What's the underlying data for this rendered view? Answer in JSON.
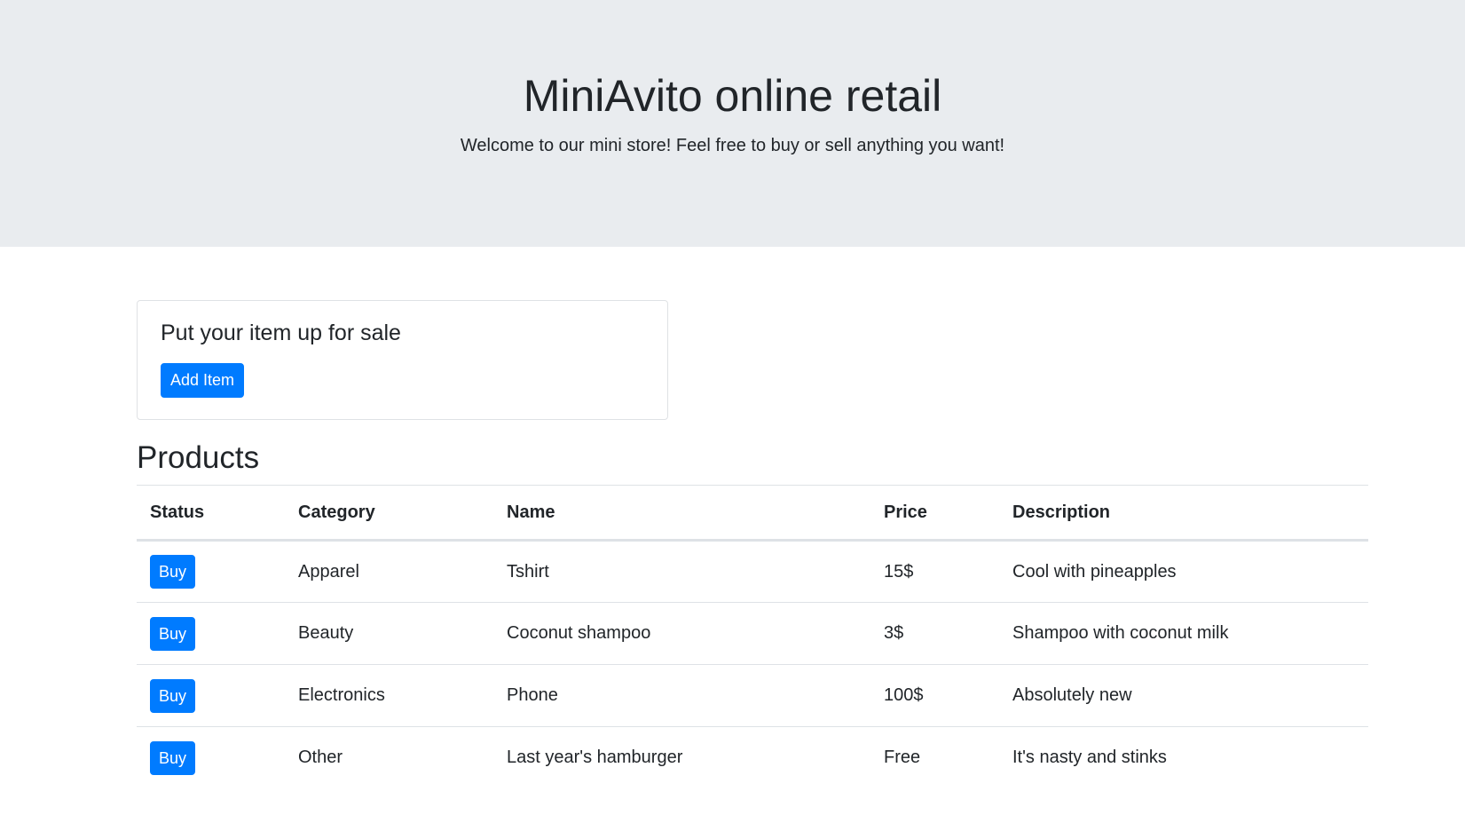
{
  "header": {
    "title": "MiniAvito online retail",
    "subtitle": "Welcome to our mini store! Feel free to buy or sell anything you want!"
  },
  "sell_card": {
    "heading": "Put your item up for sale",
    "add_button": "Add Item"
  },
  "products": {
    "title": "Products",
    "columns": {
      "status": "Status",
      "category": "Category",
      "name": "Name",
      "price": "Price",
      "description": "Description"
    },
    "rows": [
      {
        "button": "Buy",
        "category": "Apparel",
        "name": "Tshirt",
        "price": "15$",
        "description": "Cool with pineapples"
      },
      {
        "button": "Buy",
        "category": "Beauty",
        "name": "Coconut shampoo",
        "price": "3$",
        "description": "Shampoo with coconut milk"
      },
      {
        "button": "Buy",
        "category": "Electronics",
        "name": "Phone",
        "price": "100$",
        "description": "Absolutely new"
      },
      {
        "button": "Buy",
        "category": "Other",
        "name": "Last year's hamburger",
        "price": "Free",
        "description": "It's nasty and stinks"
      }
    ]
  },
  "colors": {
    "primary": "#007bff",
    "jumbotron_bg": "#e9ecef",
    "text": "#212529",
    "border": "#dee2e6"
  }
}
